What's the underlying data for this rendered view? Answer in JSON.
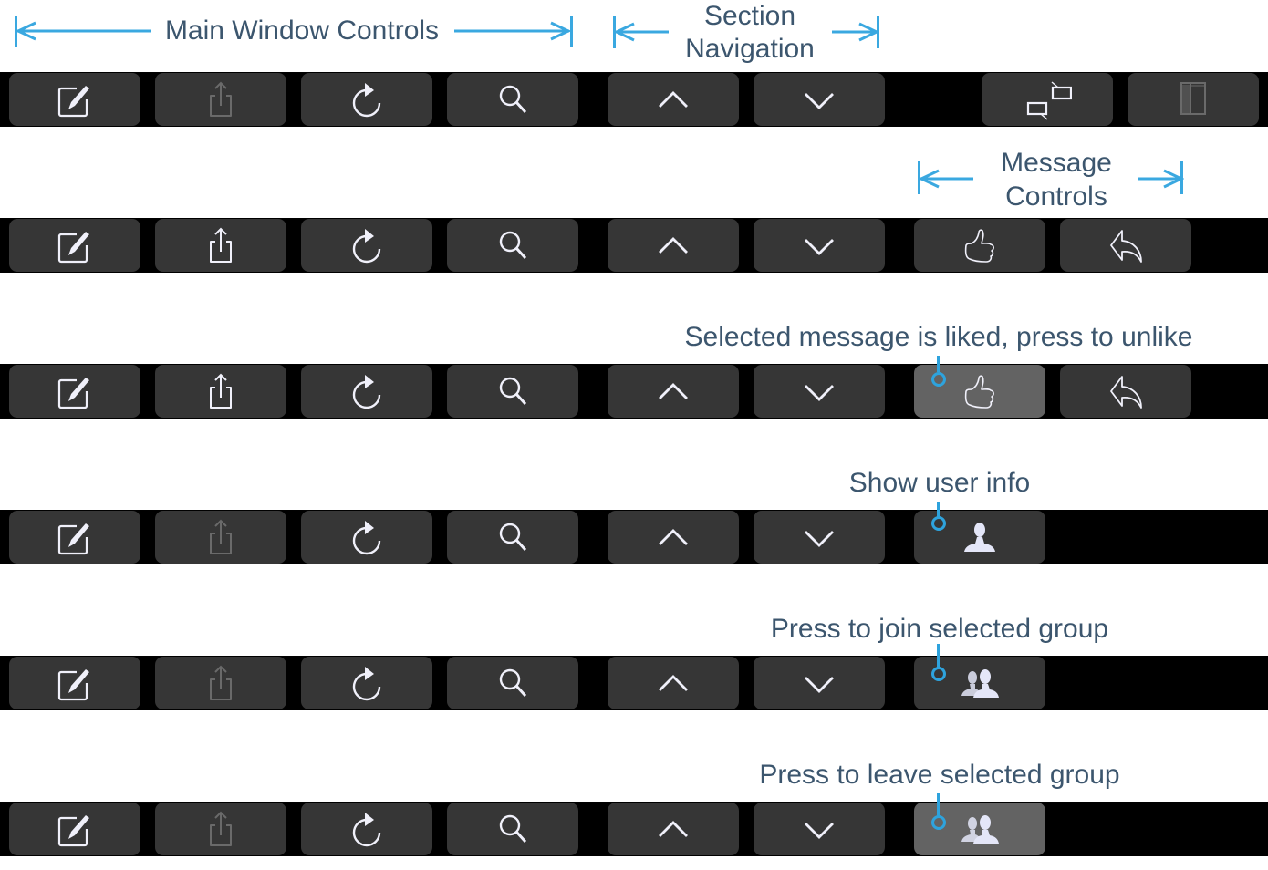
{
  "annotations": {
    "main_window_controls": "Main Window Controls",
    "section_navigation_line1": "Section",
    "section_navigation_line2": "Navigation",
    "message_controls_line1": "Message",
    "message_controls_line2": "Controls",
    "liked_callout": "Selected message is liked, press to unlike",
    "user_info_callout": "Show user info",
    "join_group_callout": "Press to join selected group",
    "leave_group_callout": "Press to leave selected group"
  },
  "colors": {
    "annotation_text": "#3c566e",
    "annotation_accent": "#3aa8e0",
    "bar_background": "#000000",
    "button_background": "#363636",
    "button_active_background": "#636363",
    "icon_enabled": "#ffffff",
    "icon_disabled": "#6a6a6a"
  },
  "touch_bars": [
    {
      "name": "default",
      "buttons": [
        {
          "id": "compose",
          "icon": "compose-icon",
          "enabled": true
        },
        {
          "id": "share",
          "icon": "share-icon",
          "enabled": false
        },
        {
          "id": "refresh",
          "icon": "refresh-icon",
          "enabled": true
        },
        {
          "id": "search",
          "icon": "search-icon",
          "enabled": true
        },
        {
          "id": "previous-section",
          "icon": "chevron-up-icon",
          "enabled": true
        },
        {
          "id": "next-section",
          "icon": "chevron-down-icon",
          "enabled": true
        },
        {
          "id": "conversations",
          "icon": "conversation-icon",
          "enabled": true
        },
        {
          "id": "toggle-sidebar",
          "icon": "sidebar-icon",
          "enabled": false
        }
      ]
    },
    {
      "name": "message",
      "buttons": [
        {
          "id": "compose",
          "icon": "compose-icon",
          "enabled": true
        },
        {
          "id": "share",
          "icon": "share-icon",
          "enabled": true
        },
        {
          "id": "refresh",
          "icon": "refresh-icon",
          "enabled": true
        },
        {
          "id": "search",
          "icon": "search-icon",
          "enabled": true
        },
        {
          "id": "previous-section",
          "icon": "chevron-up-icon",
          "enabled": true
        },
        {
          "id": "next-section",
          "icon": "chevron-down-icon",
          "enabled": true
        },
        {
          "id": "like",
          "icon": "thumbs-up-icon",
          "enabled": true,
          "active": false
        },
        {
          "id": "reply",
          "icon": "reply-icon",
          "enabled": true
        }
      ]
    },
    {
      "name": "message-liked",
      "buttons": [
        {
          "id": "compose",
          "icon": "compose-icon",
          "enabled": true
        },
        {
          "id": "share",
          "icon": "share-icon",
          "enabled": true
        },
        {
          "id": "refresh",
          "icon": "refresh-icon",
          "enabled": true
        },
        {
          "id": "search",
          "icon": "search-icon",
          "enabled": true
        },
        {
          "id": "previous-section",
          "icon": "chevron-up-icon",
          "enabled": true
        },
        {
          "id": "next-section",
          "icon": "chevron-down-icon",
          "enabled": true
        },
        {
          "id": "unlike",
          "icon": "thumbs-up-icon",
          "enabled": true,
          "active": true
        },
        {
          "id": "reply",
          "icon": "reply-icon",
          "enabled": true
        }
      ]
    },
    {
      "name": "user",
      "buttons": [
        {
          "id": "compose",
          "icon": "compose-icon",
          "enabled": true
        },
        {
          "id": "share",
          "icon": "share-icon",
          "enabled": false
        },
        {
          "id": "refresh",
          "icon": "refresh-icon",
          "enabled": true
        },
        {
          "id": "search",
          "icon": "search-icon",
          "enabled": true
        },
        {
          "id": "previous-section",
          "icon": "chevron-up-icon",
          "enabled": true
        },
        {
          "id": "next-section",
          "icon": "chevron-down-icon",
          "enabled": true
        },
        {
          "id": "user-info",
          "icon": "user-icon",
          "enabled": true
        }
      ]
    },
    {
      "name": "group-join",
      "buttons": [
        {
          "id": "compose",
          "icon": "compose-icon",
          "enabled": true
        },
        {
          "id": "share",
          "icon": "share-icon",
          "enabled": false
        },
        {
          "id": "refresh",
          "icon": "refresh-icon",
          "enabled": true
        },
        {
          "id": "search",
          "icon": "search-icon",
          "enabled": true
        },
        {
          "id": "previous-section",
          "icon": "chevron-up-icon",
          "enabled": true
        },
        {
          "id": "next-section",
          "icon": "chevron-down-icon",
          "enabled": true
        },
        {
          "id": "join-group",
          "icon": "group-icon",
          "enabled": true,
          "active": false
        }
      ]
    },
    {
      "name": "group-leave",
      "buttons": [
        {
          "id": "compose",
          "icon": "compose-icon",
          "enabled": true
        },
        {
          "id": "share",
          "icon": "share-icon",
          "enabled": false
        },
        {
          "id": "refresh",
          "icon": "refresh-icon",
          "enabled": true
        },
        {
          "id": "search",
          "icon": "search-icon",
          "enabled": true
        },
        {
          "id": "previous-section",
          "icon": "chevron-up-icon",
          "enabled": true
        },
        {
          "id": "next-section",
          "icon": "chevron-down-icon",
          "enabled": true
        },
        {
          "id": "leave-group",
          "icon": "group-icon",
          "enabled": true,
          "active": true
        }
      ]
    }
  ]
}
